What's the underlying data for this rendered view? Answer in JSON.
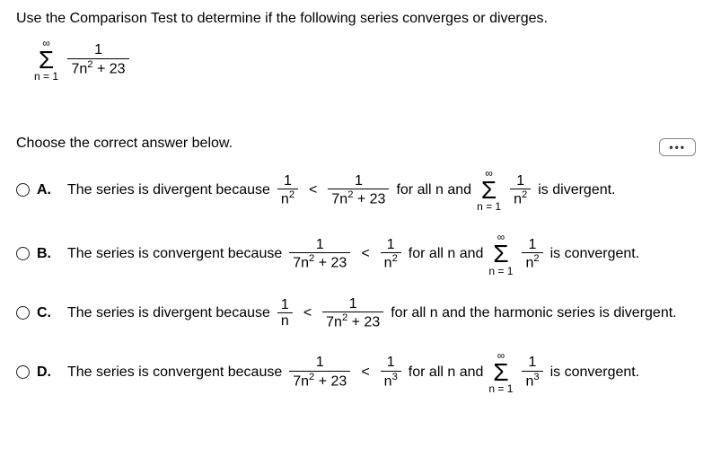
{
  "question": "Use the Comparison Test to determine if the following series converges or diverges.",
  "series": {
    "top": "∞",
    "bottom": "n = 1",
    "frac_num": "1",
    "frac_den": "7n² + 23"
  },
  "ellipsis": "•••",
  "choose": "Choose the correct answer below.",
  "options": {
    "A": {
      "label": "A.",
      "lead": "The series is divergent because",
      "cmp_left_num": "1",
      "cmp_left_den": "n²",
      "cmp_op": "<",
      "cmp_right_num": "1",
      "cmp_right_den": "7n² + 23",
      "mid": "for all n and",
      "sum_top": "∞",
      "sum_bot": "n = 1",
      "sum_frac_num": "1",
      "sum_frac_den": "n²",
      "tail": "is divergent."
    },
    "B": {
      "label": "B.",
      "lead": "The series is convergent because",
      "cmp_left_num": "1",
      "cmp_left_den": "7n² + 23",
      "cmp_op": "<",
      "cmp_right_num": "1",
      "cmp_right_den": "n²",
      "mid": "for all n and",
      "sum_top": "∞",
      "sum_bot": "n = 1",
      "sum_frac_num": "1",
      "sum_frac_den": "n²",
      "tail": "is convergent."
    },
    "C": {
      "label": "C.",
      "lead": "The series is divergent because",
      "cmp_left_num": "1",
      "cmp_left_den": "n",
      "cmp_op": "<",
      "cmp_right_num": "1",
      "cmp_right_den": "7n² + 23",
      "mid": "for all n and the harmonic series is divergent.",
      "has_sum": false
    },
    "D": {
      "label": "D.",
      "lead": "The series is convergent because",
      "cmp_left_num": "1",
      "cmp_left_den": "7n² + 23",
      "cmp_op": "<",
      "cmp_right_num": "1",
      "cmp_right_den": "n³",
      "mid": "for all n and",
      "sum_top": "∞",
      "sum_bot": "n = 1",
      "sum_frac_num": "1",
      "sum_frac_den": "n³",
      "tail": "is convergent."
    }
  }
}
